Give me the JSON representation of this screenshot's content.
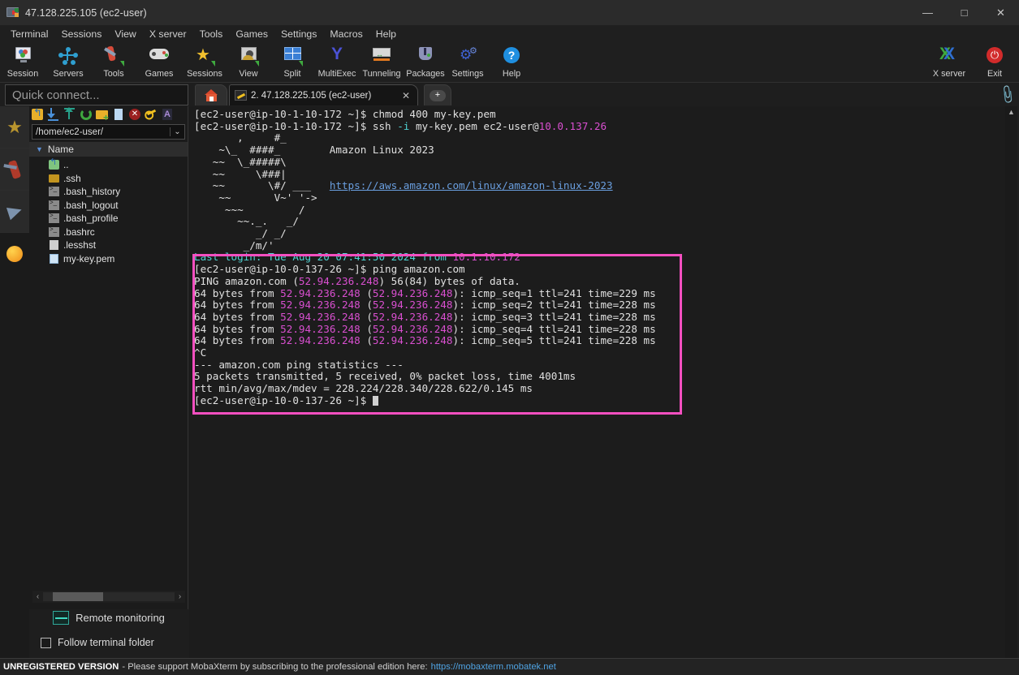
{
  "window": {
    "title": "47.128.225.105 (ec2-user)",
    "icon": "mobaxterm-icon",
    "minimize": "—",
    "maximize": "□",
    "close": "✕"
  },
  "menubar": {
    "items": [
      {
        "label": "Terminal"
      },
      {
        "label": "Sessions"
      },
      {
        "label": "View"
      },
      {
        "label": "X server"
      },
      {
        "label": "Tools"
      },
      {
        "label": "Games"
      },
      {
        "label": "Settings"
      },
      {
        "label": "Macros"
      },
      {
        "label": "Help"
      }
    ]
  },
  "toolbar": {
    "buttons": [
      {
        "label": "Session",
        "icon": "session-icon"
      },
      {
        "label": "Servers",
        "icon": "servers-icon"
      },
      {
        "label": "Tools",
        "icon": "tools-icon"
      },
      {
        "label": "Games",
        "icon": "games-icon"
      },
      {
        "label": "Sessions",
        "icon": "sessions-star-icon"
      },
      {
        "label": "View",
        "icon": "view-icon"
      },
      {
        "label": "Split",
        "icon": "split-icon"
      },
      {
        "label": "MultiExec",
        "icon": "multiexec-icon"
      },
      {
        "label": "Tunneling",
        "icon": "tunneling-icon"
      },
      {
        "label": "Packages",
        "icon": "packages-icon"
      },
      {
        "label": "Settings",
        "icon": "settings-gear-icon"
      },
      {
        "label": "Help",
        "icon": "help-question-icon"
      }
    ],
    "right_buttons": [
      {
        "label": "X server",
        "icon": "xserver-icon"
      },
      {
        "label": "Exit",
        "icon": "power-exit-icon"
      }
    ]
  },
  "quick_connect": {
    "placeholder": "Quick connect...",
    "value": ""
  },
  "tabs": {
    "home_icon": "home-icon",
    "items": [
      {
        "label": "2. 47.128.225.105 (ec2-user)",
        "icon": "key-icon",
        "close": "✕",
        "active": true
      }
    ],
    "new_tab": "+"
  },
  "clip_button": {
    "icon": "paperclip-icon"
  },
  "sidebar_strip": {
    "items": [
      {
        "icon": "star-favorites-icon",
        "name": "favorites"
      },
      {
        "icon": "tools-knife-icon",
        "name": "tools"
      },
      {
        "icon": "paper-plane-sftp-icon",
        "name": "sftp"
      },
      {
        "icon": "globe-macros-icon",
        "name": "macros"
      }
    ]
  },
  "file_browser": {
    "toolbar_icons": [
      "go-up-folder-icon",
      "download-icon",
      "upload-icon",
      "refresh-icon",
      "new-folder-icon",
      "new-file-icon",
      "delete-icon",
      "permissions-key-icon",
      "text-mode-icon"
    ],
    "path": "/home/ec2-user/",
    "path_dropdown": "⌄",
    "column_header": "Name",
    "sort_arrow": "▼",
    "files": [
      {
        "name": "..",
        "type": "parent"
      },
      {
        "name": ".ssh",
        "type": "folder"
      },
      {
        "name": ".bash_history",
        "type": "script"
      },
      {
        "name": ".bash_logout",
        "type": "script"
      },
      {
        "name": ".bash_profile",
        "type": "script"
      },
      {
        "name": ".bashrc",
        "type": "script"
      },
      {
        "name": ".lesshst",
        "type": "document"
      },
      {
        "name": "my-key.pem",
        "type": "certificate"
      }
    ],
    "hscroll": {
      "left_arrow": "‹",
      "right_arrow": "›"
    },
    "remote_monitoring": "Remote monitoring",
    "follow_terminal_folder": {
      "label": "Follow terminal folder",
      "checked": false
    }
  },
  "terminal": {
    "lines": [
      [
        {
          "t": "[ec2-user@ip-10-1-10-172 ~]$ chmod 400 my-key.pem",
          "c": "white"
        }
      ],
      [
        {
          "t": "[ec2-user@ip-10-1-10-172 ~]$ ssh ",
          "c": "white"
        },
        {
          "t": "-i",
          "c": "cyan"
        },
        {
          "t": " my-key.pem ec2-user@",
          "c": "white"
        },
        {
          "t": "10.0.137.26",
          "c": "magenta"
        }
      ],
      [
        {
          "t": "       ,     #_",
          "c": "white"
        }
      ],
      [
        {
          "t": "    ~\\_  ####_        Amazon Linux 2023",
          "c": "white"
        }
      ],
      [
        {
          "t": "   ~~  \\_#####\\",
          "c": "white"
        }
      ],
      [
        {
          "t": "   ~~     \\###|",
          "c": "white"
        }
      ],
      [
        {
          "t": "   ~~       \\#/ ___   ",
          "c": "white"
        },
        {
          "t": "https://aws.amazon.com/linux/amazon-linux-2023",
          "c": "blue-underline"
        }
      ],
      [
        {
          "t": "    ~~       V~' '->",
          "c": "white"
        }
      ],
      [
        {
          "t": "     ~~~         /",
          "c": "white"
        }
      ],
      [
        {
          "t": "       ~~._.   _/",
          "c": "white"
        }
      ],
      [
        {
          "t": "          _/ _/",
          "c": "white"
        }
      ],
      [
        {
          "t": "        _/m/'",
          "c": "white"
        }
      ],
      [
        {
          "t": "Last login: Tue Aug 20 07:41:50 2024 from ",
          "c": "cyan"
        },
        {
          "t": "10.1.10.172",
          "c": "magenta"
        }
      ],
      [
        {
          "t": "[ec2-user@ip-10-0-137-26 ~]$ ping amazon.com",
          "c": "white"
        }
      ],
      [
        {
          "t": "PING amazon.com (",
          "c": "white"
        },
        {
          "t": "52.94.236.248",
          "c": "magenta"
        },
        {
          "t": ") 56(84) bytes of data.",
          "c": "white"
        }
      ],
      [
        {
          "t": "64 bytes from ",
          "c": "white"
        },
        {
          "t": "52.94.236.248",
          "c": "magenta"
        },
        {
          "t": " (",
          "c": "white"
        },
        {
          "t": "52.94.236.248",
          "c": "magenta"
        },
        {
          "t": "): icmp_seq=1 ttl=241 time=229 ms",
          "c": "white"
        }
      ],
      [
        {
          "t": "64 bytes from ",
          "c": "white"
        },
        {
          "t": "52.94.236.248",
          "c": "magenta"
        },
        {
          "t": " (",
          "c": "white"
        },
        {
          "t": "52.94.236.248",
          "c": "magenta"
        },
        {
          "t": "): icmp_seq=2 ttl=241 time=228 ms",
          "c": "white"
        }
      ],
      [
        {
          "t": "64 bytes from ",
          "c": "white"
        },
        {
          "t": "52.94.236.248",
          "c": "magenta"
        },
        {
          "t": " (",
          "c": "white"
        },
        {
          "t": "52.94.236.248",
          "c": "magenta"
        },
        {
          "t": "): icmp_seq=3 ttl=241 time=228 ms",
          "c": "white"
        }
      ],
      [
        {
          "t": "64 bytes from ",
          "c": "white"
        },
        {
          "t": "52.94.236.248",
          "c": "magenta"
        },
        {
          "t": " (",
          "c": "white"
        },
        {
          "t": "52.94.236.248",
          "c": "magenta"
        },
        {
          "t": "): icmp_seq=4 ttl=241 time=228 ms",
          "c": "white"
        }
      ],
      [
        {
          "t": "64 bytes from ",
          "c": "white"
        },
        {
          "t": "52.94.236.248",
          "c": "magenta"
        },
        {
          "t": " (",
          "c": "white"
        },
        {
          "t": "52.94.236.248",
          "c": "magenta"
        },
        {
          "t": "): icmp_seq=5 ttl=241 time=228 ms",
          "c": "white"
        }
      ],
      [
        {
          "t": "^C",
          "c": "white"
        }
      ],
      [
        {
          "t": "--- ",
          "c": "white"
        },
        {
          "t": "amazon.com",
          "c": "white"
        },
        {
          "t": " ping statistics ---",
          "c": "white"
        }
      ],
      [
        {
          "t": "5 packets transmitted, 5 received, 0% packet loss, time 4001ms",
          "c": "white"
        }
      ],
      [
        {
          "t": "rtt min/avg/max/mdev = 228.224/228.340/228.622/0.145 ms",
          "c": "white"
        }
      ],
      [
        {
          "t": "[ec2-user@ip-10-0-137-26 ~]$ ",
          "c": "white"
        },
        {
          "t": "CURSOR",
          "c": "cursor"
        }
      ]
    ],
    "highlight_color": "#f54fc0"
  },
  "statusbar": {
    "unregistered": "UNREGISTERED VERSION",
    "message": "-  Please support MobaXterm by subscribing to the professional edition here:",
    "link": "https://mobaxterm.mobatek.net"
  }
}
